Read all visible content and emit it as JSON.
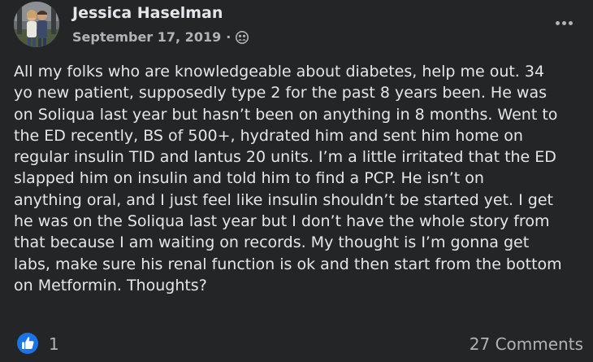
{
  "post": {
    "author": "Jessica Haselman",
    "date": "September 17, 2019",
    "separator": "·",
    "privacy_icon": "group-icon",
    "more_icon": "more-options-icon",
    "body_lines": [
      "All my folks who are knowledgeable about diabetes, help me out. 34",
      "yo new patient, supposedly type 2 for the past 8 years been. He was",
      "on Soliqua last year but hasn’t been on anything in 8 months. Went to",
      "the ED recently, BS of 500+, hydrated him and sent him home on",
      "regular insulin TID and lantus 20 units. I’m a little irritated that the ED",
      "slapped him on insulin and told him to find a PCP. He isn’t on",
      "anything oral, and I just feel like insulin shouldn’t be started yet. I get",
      "he was on the Soliqua last year but I don’t have the whole story from",
      "that because I am waiting on records. My thought is I’m gonna get",
      "labs, make sure his renal function is ok and then start from the bottom",
      "on Metformin. Thoughts?"
    ]
  },
  "footer": {
    "reaction_icon": "like-icon",
    "reaction_count": "1",
    "comments": "27 Comments"
  },
  "colors": {
    "background": "#242526",
    "primary_text": "#e4e6eb",
    "secondary_text": "#b0b3b8",
    "like_blue": "#1b74e4"
  }
}
